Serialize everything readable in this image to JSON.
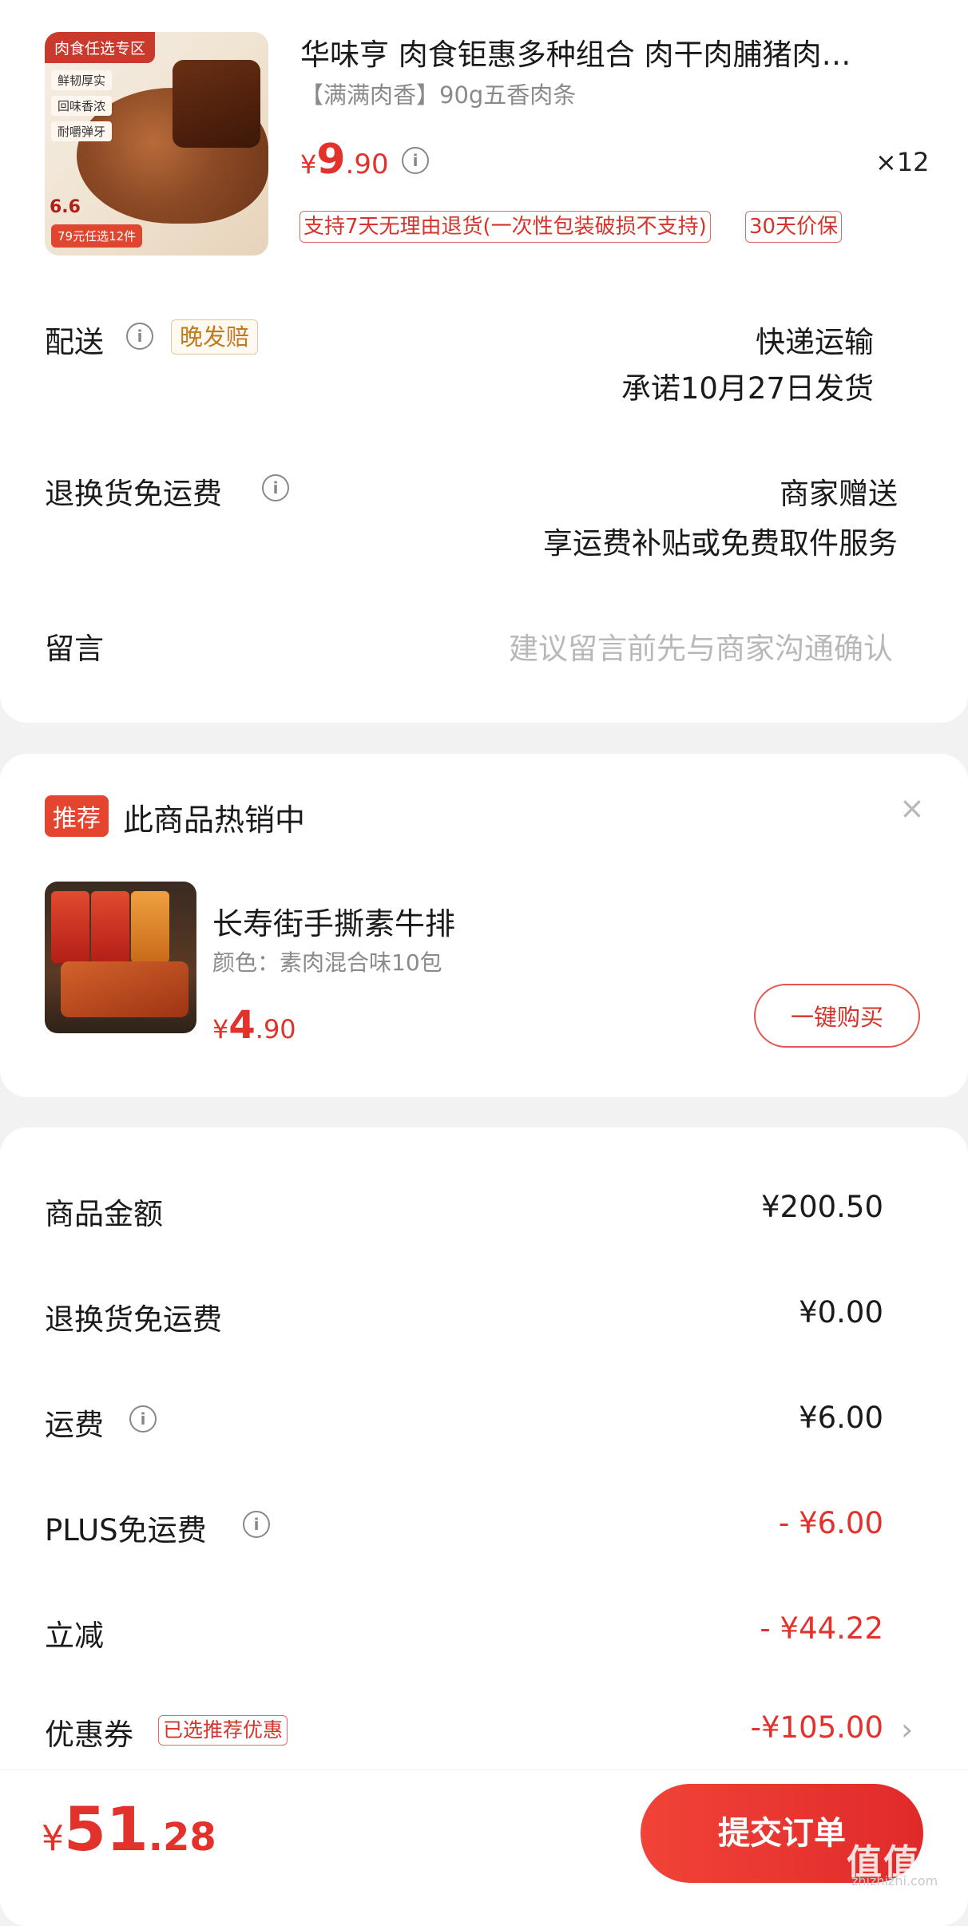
{
  "product": {
    "title": "华味亨 肉食钜惠多种组合 肉干肉脯猪肉…",
    "spec": "【满满肉香】90g五香肉条",
    "price_currency": "¥",
    "price_int": "9",
    "price_dec": ".90",
    "quantity": "×12",
    "tag_return": "支持7天无理由退货(一次性包装破损不支持)",
    "tag_price_protect": "30天价保",
    "thumb": {
      "zone_tag": "肉食任选专区",
      "chip1": "鲜韧厚实",
      "chip2": "回味香浓",
      "chip3": "耐嚼弹牙",
      "small_price": "6.6",
      "promo": "79元任选12件"
    }
  },
  "delivery": {
    "label": "配送",
    "badge": "晚发赔",
    "method": "快递运输",
    "promise": "承诺10月27日发货"
  },
  "return_shipping": {
    "label": "退换货免运费",
    "provider": "商家赠送",
    "desc": "享运费补贴或免费取件服务"
  },
  "message": {
    "label": "留言",
    "placeholder": "建议留言前先与商家沟通确认"
  },
  "recommend": {
    "tag": "推荐",
    "title": "此商品热销中",
    "close": "×",
    "name": "长寿街手撕素牛排",
    "color": "颜色：素肉混合味10包",
    "price_currency": "¥",
    "price_int": "4",
    "price_dec": ".90",
    "button": "一键购买"
  },
  "summary": {
    "goods_label": "商品金额",
    "goods_value": "¥200.50",
    "return_label": "退换货免运费",
    "return_value": "¥0.00",
    "freight_label": "运费",
    "freight_value": "¥6.00",
    "plus_label": "PLUS免运费",
    "plus_value": "- ¥6.00",
    "discount_label": "立减",
    "discount_value": "- ¥44.22",
    "coupon_label": "优惠券",
    "coupon_tag": "已选推荐优惠",
    "coupon_value": "-¥105.00",
    "chevron": "›"
  },
  "footer": {
    "total_currency": "¥",
    "total_int": "51",
    "total_dec": ".28",
    "submit": "提交订单",
    "watermark": "值值值",
    "watermark_url": "zhizhizhi.com"
  },
  "colors": {
    "accent": "#e2322b",
    "background": "#f2f2f2"
  }
}
